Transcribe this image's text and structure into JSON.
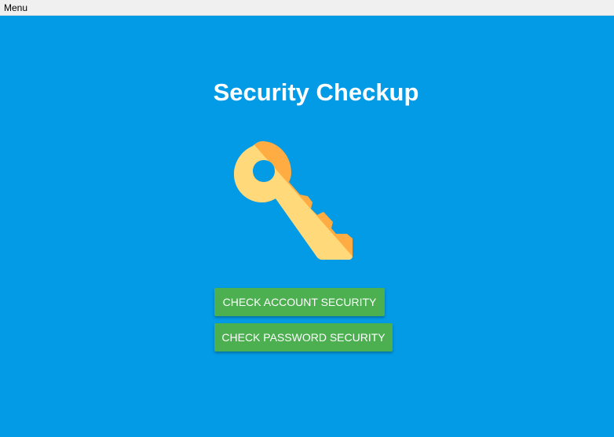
{
  "menubar": {
    "menu_label": "Menu"
  },
  "main": {
    "title": "Security Checkup",
    "hero_icon": "key-icon",
    "buttons": {
      "account_label": "CHECK ACCOUNT SECURITY",
      "password_label": "CHECK PASSWORD SECURITY"
    }
  },
  "colors": {
    "background": "#039be5",
    "button": "#4caf50",
    "menubar": "#f0f0f0",
    "key_light": "#ffd97a",
    "key_dark": "#ffad42"
  }
}
